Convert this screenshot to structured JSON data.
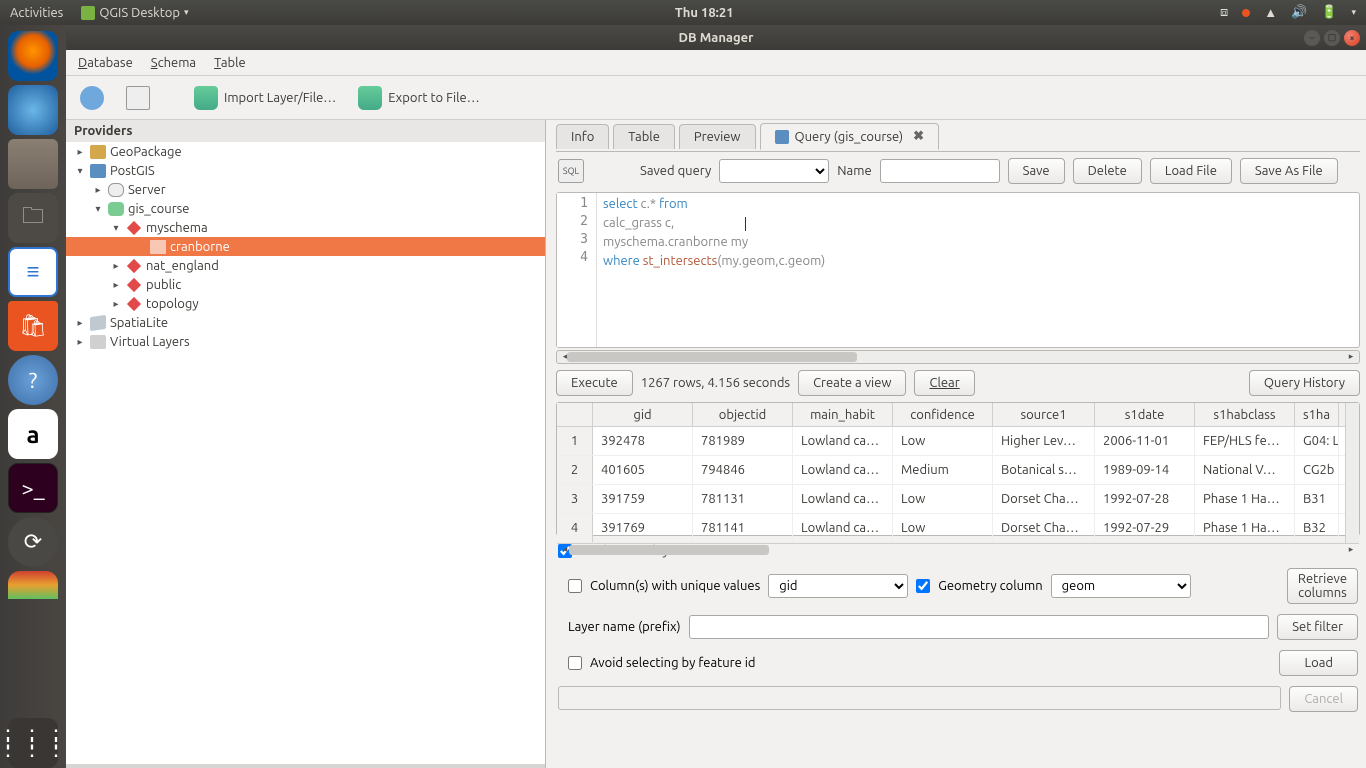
{
  "top_panel": {
    "activities": "Activities",
    "app_title": "QGIS Desktop",
    "clock": "Thu 18:21"
  },
  "window": {
    "title": "DB Manager"
  },
  "menubar": {
    "database": "Database",
    "schema": "Schema",
    "table": "Table"
  },
  "toolbar": {
    "import_layer": "Import Layer/File…",
    "export_file": "Export to File…"
  },
  "providers": {
    "title": "Providers",
    "items": {
      "geopackage": "GeoPackage",
      "postgis": "PostGIS",
      "server": "Server",
      "gis_course": "gis_course",
      "myschema": "myschema",
      "cranborne": "cranborne",
      "nat_england": "nat_england",
      "public": "public",
      "topology": "topology",
      "spatialite": "SpatiaLite",
      "virtual": "Virtual Layers"
    }
  },
  "tabs": {
    "info": "Info",
    "table": "Table",
    "preview": "Preview",
    "query": "Query (gis_course)"
  },
  "query_bar": {
    "saved_query": "Saved query",
    "name": "Name",
    "save": "Save",
    "delete": "Delete",
    "load_file": "Load File",
    "save_as_file": "Save As File"
  },
  "editor": {
    "line1_kw1": "select",
    "line1_id1": " c.* ",
    "line1_kw2": "from",
    "line2": "calc_grass c,",
    "line3": "myschema.cranborne my",
    "line4_kw": "where",
    "line4_sp": " ",
    "line4_fn": "st_intersects",
    "line4_rest": "(my.geom,c.geom)"
  },
  "exec_bar": {
    "execute": "Execute",
    "status": "1267 rows, 4.156 seconds",
    "create_view": "Create a view",
    "clear": "Clear",
    "history": "Query History"
  },
  "results": {
    "columns": [
      "gid",
      "objectid",
      "main_habit",
      "confidence",
      "source1",
      "s1date",
      "s1habclass",
      "s1ha"
    ],
    "rows": [
      {
        "idx": "1",
        "gid": "392478",
        "objectid": "781989",
        "main_habit": "Lowland ca…",
        "confidence": "Low",
        "source1": "Higher Lev…",
        "s1date": "2006-11-01",
        "s1habclass": "FEP/HLS fe…",
        "s1ha": "G04: L"
      },
      {
        "idx": "2",
        "gid": "401605",
        "objectid": "794846",
        "main_habit": "Lowland ca…",
        "confidence": "Medium",
        "source1": "Botanical s…",
        "s1date": "1989-09-14",
        "s1habclass": "National V…",
        "s1ha": "CG2b"
      },
      {
        "idx": "3",
        "gid": "391759",
        "objectid": "781131",
        "main_habit": "Lowland ca…",
        "confidence": "Low",
        "source1": "Dorset Cha…",
        "s1date": "1992-07-28",
        "s1habclass": "Phase 1 Ha…",
        "s1ha": "B31"
      },
      {
        "idx": "4",
        "gid": "391769",
        "objectid": "781141",
        "main_habit": "Lowland ca…",
        "confidence": "Low",
        "source1": "Dorset Cha…",
        "s1date": "1992-07-29",
        "s1habclass": "Phase 1 Ha…",
        "s1ha": "B32"
      }
    ]
  },
  "lower": {
    "load_as_layer": "Load as new layer",
    "unique_cols": "Column(s) with unique values",
    "unique_val": "gid",
    "geom_col": "Geometry column",
    "geom_val": "geom",
    "retrieve": "Retrieve\ncolumns",
    "layer_prefix": "Layer name (prefix)",
    "set_filter": "Set filter",
    "avoid_fid": "Avoid selecting by feature id",
    "load": "Load",
    "cancel": "Cancel"
  }
}
